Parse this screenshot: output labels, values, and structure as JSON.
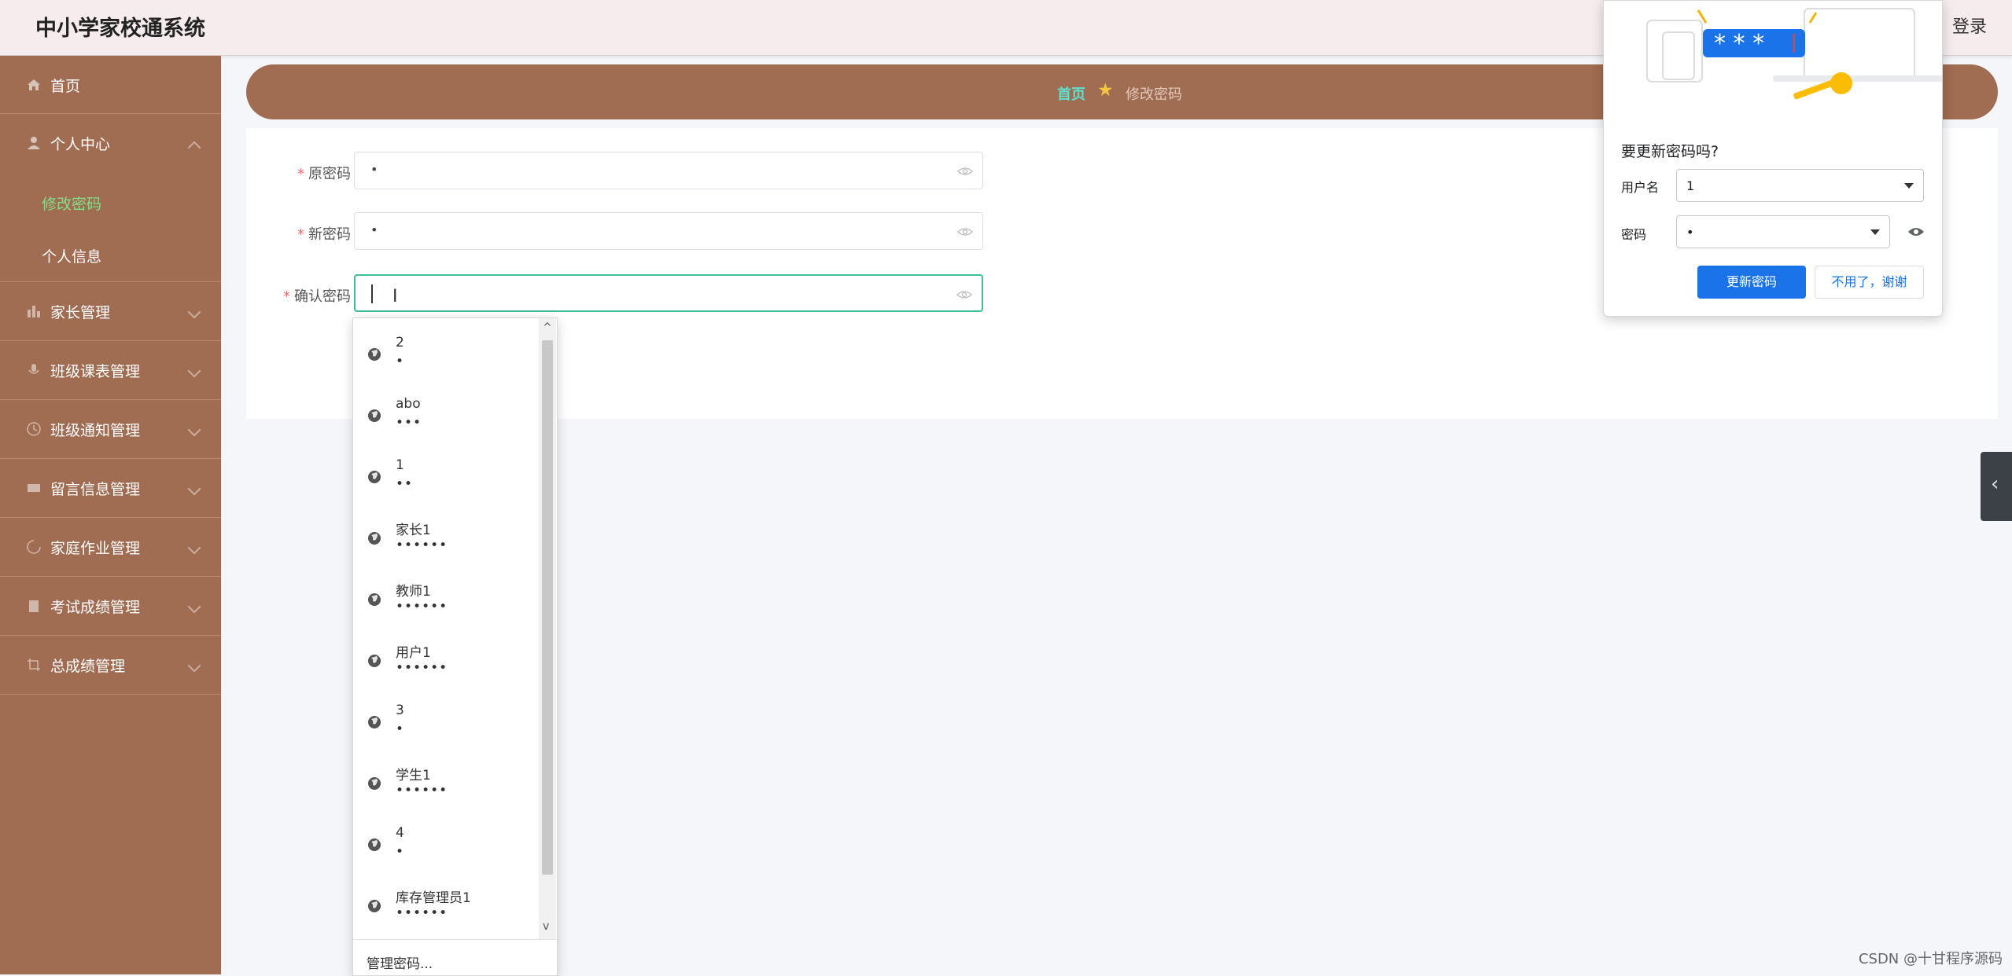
{
  "header": {
    "app_title": "中小学家校通系统",
    "logout_label": "登录"
  },
  "sidebar": {
    "home": "首页",
    "personal_center": "个人中心",
    "sub_items": [
      "修改密码",
      "个人信息"
    ],
    "groups": [
      "家长管理",
      "班级课表管理",
      "班级通知管理",
      "留言信息管理",
      "家庭作业管理",
      "考试成绩管理",
      "总成绩管理"
    ]
  },
  "breadcrumb": {
    "home": "首页",
    "current": "修改密码"
  },
  "form": {
    "old_password_label": "原密码",
    "old_password_value": "•",
    "new_password_label": "新密码",
    "new_password_value": "•",
    "confirm_password_label": "确认密码",
    "required_mark": "*"
  },
  "autofill": {
    "entries": [
      {
        "user": "2",
        "pass": "•"
      },
      {
        "user": "abo",
        "pass": "•••"
      },
      {
        "user": "1",
        "pass": "••"
      },
      {
        "user": "家长1",
        "pass": "••••••"
      },
      {
        "user": "教师1",
        "pass": "••••••"
      },
      {
        "user": "用户1",
        "pass": "••••••"
      },
      {
        "user": "3",
        "pass": "•"
      },
      {
        "user": "学生1",
        "pass": "••••••"
      },
      {
        "user": "4",
        "pass": "•"
      },
      {
        "user": "库存管理员1",
        "pass": "••••••"
      }
    ],
    "manage_label": "管理密码..."
  },
  "password_popup": {
    "title": "要更新密码吗?",
    "username_label": "用户名",
    "username_value": "1",
    "password_label": "密码",
    "password_value": "•",
    "update_button": "更新密码",
    "dismiss_button": "不用了，谢谢"
  },
  "watermark": "CSDN @十甘程序源码",
  "colors": {
    "sidebar": "#a06c52",
    "active_submenu": "#7fe08a",
    "breadcrumb_home": "#5fe0d0",
    "primary_button": "#1a73e8",
    "focus_border": "#3dbd9a"
  }
}
